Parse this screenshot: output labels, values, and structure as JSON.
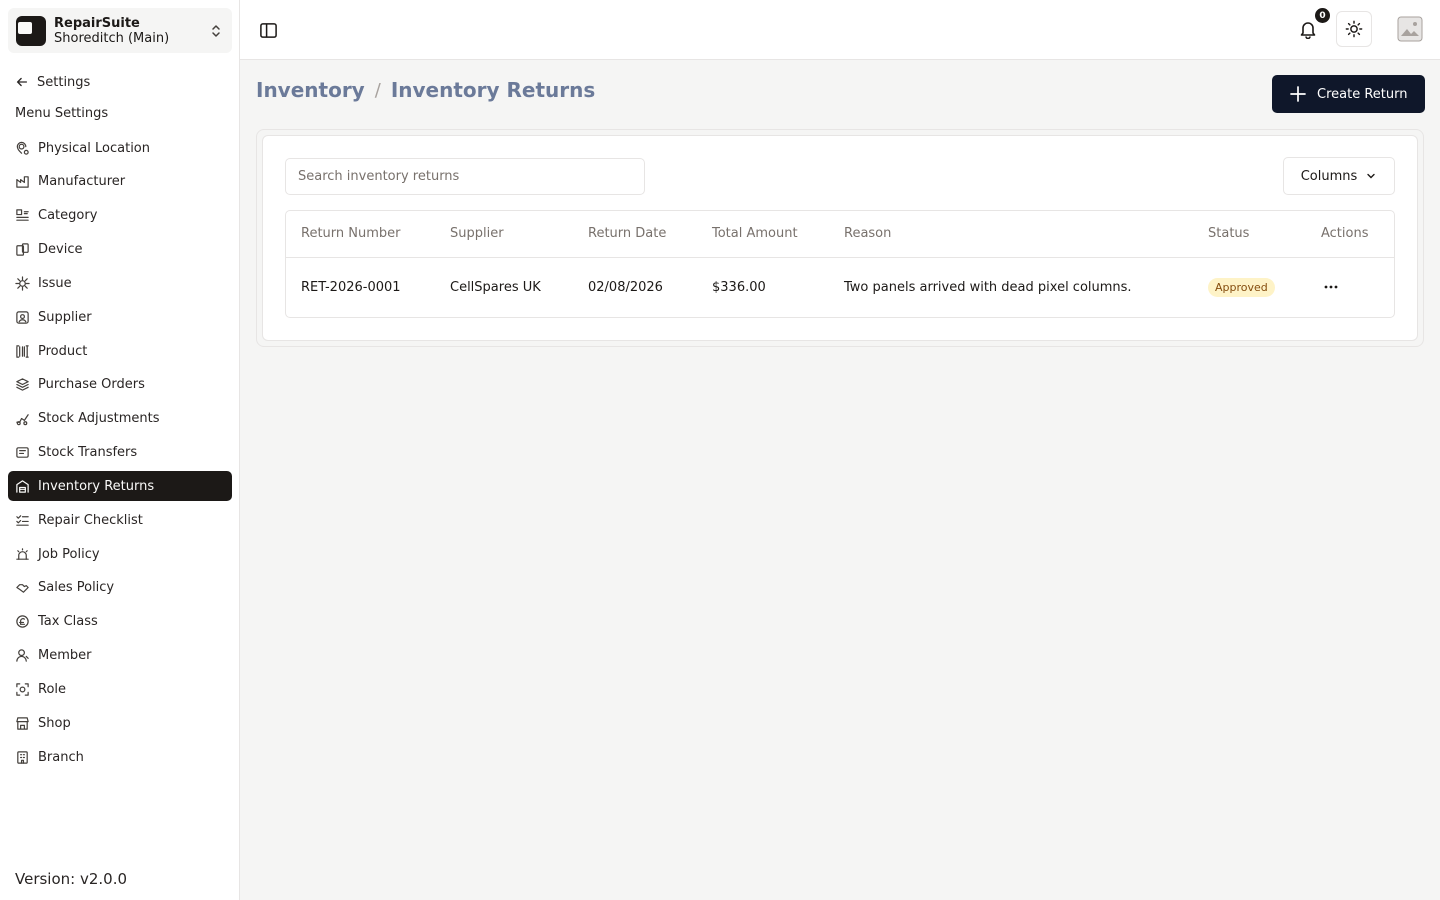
{
  "org": {
    "name": "RepairSuite",
    "branch": "Shoreditch (Main)"
  },
  "sidebar": {
    "back_label": "Settings",
    "heading": "Menu Settings",
    "items": [
      {
        "label": "Physical Location",
        "icon": "location-icon"
      },
      {
        "label": "Manufacturer",
        "icon": "factory-icon"
      },
      {
        "label": "Category",
        "icon": "category-icon"
      },
      {
        "label": "Device",
        "icon": "device-icon"
      },
      {
        "label": "Issue",
        "icon": "bug-icon"
      },
      {
        "label": "Supplier",
        "icon": "supplier-icon"
      },
      {
        "label": "Product",
        "icon": "barcode-icon"
      },
      {
        "label": "Purchase Orders",
        "icon": "layers-icon"
      },
      {
        "label": "Stock Adjustments",
        "icon": "adjust-icon"
      },
      {
        "label": "Stock Transfers",
        "icon": "transfer-icon"
      },
      {
        "label": "Inventory Returns",
        "icon": "warehouse-icon",
        "active": true
      },
      {
        "label": "Repair Checklist",
        "icon": "checklist-icon"
      },
      {
        "label": "Job Policy",
        "icon": "siren-icon"
      },
      {
        "label": "Sales Policy",
        "icon": "handshake-icon"
      },
      {
        "label": "Tax Class",
        "icon": "currency-icon"
      },
      {
        "label": "Member",
        "icon": "user-icon"
      },
      {
        "label": "Role",
        "icon": "role-icon"
      },
      {
        "label": "Shop",
        "icon": "store-icon"
      },
      {
        "label": "Branch",
        "icon": "building-icon"
      }
    ],
    "version": "Version: v2.0.0"
  },
  "header": {
    "notification_count": "0"
  },
  "breadcrumb": {
    "parent": "Inventory",
    "separator": "/",
    "current": "Inventory Returns"
  },
  "actions": {
    "create_label": "Create Return"
  },
  "search": {
    "placeholder": "Search inventory returns",
    "value": ""
  },
  "columns_label": "Columns",
  "table": {
    "headers": [
      "Return Number",
      "Supplier",
      "Return Date",
      "Total Amount",
      "Reason",
      "Status",
      "Actions"
    ],
    "rows": [
      {
        "return_number": "RET-2026-0001",
        "supplier": "CellSpares UK",
        "return_date": "02/08/2026",
        "total_amount": "$336.00",
        "reason": "Two panels arrived with dead pixel columns.",
        "status": "Approved"
      }
    ]
  },
  "colors": {
    "accent": "#1c1917",
    "primary_button": "#0f172a",
    "breadcrumb": "#6b7a99",
    "status_approved_bg": "#fef3c7",
    "status_approved_text": "#854d0e"
  }
}
